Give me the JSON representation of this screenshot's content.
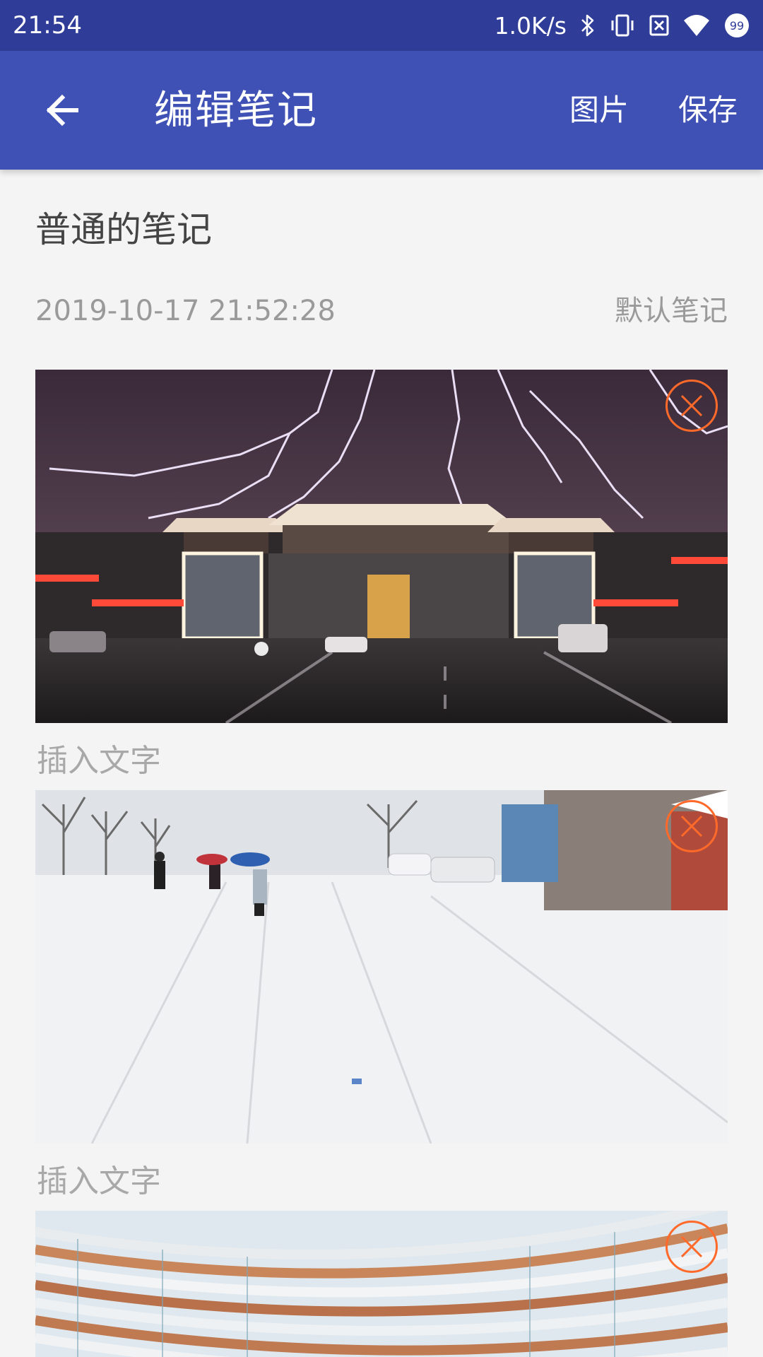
{
  "status_bar": {
    "time": "21:54",
    "network_speed": "1.0K/s",
    "icons": [
      "bluetooth-icon",
      "vibrate-icon",
      "no-sim-icon",
      "wifi-icon",
      "battery-99-icon"
    ],
    "battery_level": "99"
  },
  "app_bar": {
    "back_icon": "arrow-left-icon",
    "title": "编辑笔记",
    "actions": {
      "image": "图片",
      "save": "保存"
    }
  },
  "note": {
    "title": "普通的笔记",
    "timestamp": "2019-10-17 21:52:28",
    "category": "默认笔记"
  },
  "blocks": [
    {
      "type": "image",
      "subject": "lightning-night-gate",
      "remove_icon": "close-circle-icon"
    },
    {
      "type": "text",
      "placeholder": "插入文字"
    },
    {
      "type": "image",
      "subject": "snowy-street",
      "remove_icon": "close-circle-icon"
    },
    {
      "type": "text",
      "placeholder": "插入文字"
    },
    {
      "type": "image",
      "subject": "curved-building",
      "remove_icon": "close-circle-icon"
    }
  ],
  "colors": {
    "status_bar": "#2f3d98",
    "app_bar": "#3f51b5",
    "background": "#f4f4f4",
    "remove_accent": "#ff6a2a"
  }
}
